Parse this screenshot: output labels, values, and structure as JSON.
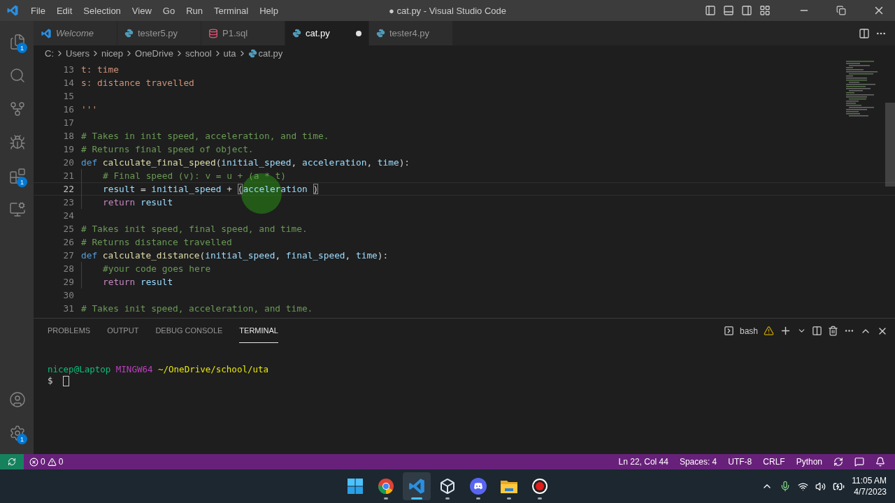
{
  "window": {
    "title": "● cat.py - Visual Studio Code"
  },
  "menu": [
    "File",
    "Edit",
    "Selection",
    "View",
    "Go",
    "Run",
    "Terminal",
    "Help"
  ],
  "activity_bar": {
    "top": [
      {
        "kind": "explorer",
        "badge": "1",
        "selected": false
      },
      {
        "kind": "search",
        "selected": false
      },
      {
        "kind": "source-control",
        "selected": false
      },
      {
        "kind": "debug",
        "selected": false
      },
      {
        "kind": "extensions",
        "badge": "1",
        "selected": false
      },
      {
        "kind": "remote",
        "selected": false
      }
    ],
    "bottom": [
      {
        "kind": "account",
        "selected": false
      },
      {
        "kind": "settings",
        "badge": "1",
        "selected": false
      }
    ]
  },
  "tabs": [
    {
      "label": "Welcome",
      "kind": "welcome",
      "preview": true,
      "selected": false,
      "modified": false
    },
    {
      "label": "tester5.py",
      "kind": "python",
      "preview": false,
      "selected": false,
      "modified": false
    },
    {
      "label": "P1.sql",
      "kind": "sql",
      "preview": false,
      "selected": false,
      "modified": false
    },
    {
      "label": "cat.py",
      "kind": "python",
      "preview": false,
      "selected": true,
      "modified": true
    },
    {
      "label": "tester4.py",
      "kind": "python",
      "preview": false,
      "selected": false,
      "modified": false
    }
  ],
  "breadcrumb": [
    {
      "label": "C:",
      "kind": "folder"
    },
    {
      "label": "Users",
      "kind": "folder"
    },
    {
      "label": "nicep",
      "kind": "folder"
    },
    {
      "label": "OneDrive",
      "kind": "folder"
    },
    {
      "label": "school",
      "kind": "folder"
    },
    {
      "label": "uta",
      "kind": "folder"
    },
    {
      "label": "cat.py",
      "kind": "python"
    }
  ],
  "editor": {
    "lines": [
      {
        "number": "13",
        "current": false,
        "indented": false,
        "tokens": [
          {
            "kind": "string",
            "text": "t: time"
          }
        ]
      },
      {
        "number": "14",
        "current": false,
        "indented": false,
        "tokens": [
          {
            "kind": "string",
            "text": "s: distance travelled"
          }
        ]
      },
      {
        "number": "15",
        "current": false
      },
      {
        "number": "16",
        "current": false,
        "indented": false,
        "tokens": [
          {
            "kind": "string",
            "text": "'''"
          }
        ]
      },
      {
        "number": "17",
        "current": false
      },
      {
        "number": "18",
        "current": false,
        "indented": false,
        "tokens": [
          {
            "kind": "comment",
            "text": "# Takes in init speed, acceleration, and time."
          }
        ]
      },
      {
        "number": "19",
        "current": false,
        "indented": false,
        "tokens": [
          {
            "kind": "comment",
            "text": "# Returns final speed of object."
          }
        ]
      },
      {
        "number": "20",
        "current": false,
        "indented": false,
        "tokens": [
          {
            "kind": "keyword",
            "text": "def "
          },
          {
            "kind": "function",
            "text": "calculate_final_speed"
          },
          {
            "kind": "plain",
            "text": "("
          },
          {
            "kind": "param",
            "text": "initial_speed"
          },
          {
            "kind": "plain",
            "text": ", "
          },
          {
            "kind": "param",
            "text": "acceleration"
          },
          {
            "kind": "plain",
            "text": ", "
          },
          {
            "kind": "param",
            "text": "time"
          },
          {
            "kind": "plain",
            "text": "):"
          }
        ]
      },
      {
        "number": "21",
        "current": false,
        "indented": true,
        "tokens": [
          {
            "kind": "comment",
            "text": "# Final speed (v): v = u + (a * t)"
          }
        ]
      },
      {
        "number": "22",
        "current": true,
        "indented": true,
        "tokens": [
          {
            "kind": "variable",
            "text": "result"
          },
          {
            "kind": "plain",
            "text": " = "
          },
          {
            "kind": "variable",
            "text": "initial_speed"
          },
          {
            "kind": "plain",
            "text": " + "
          },
          {
            "kind": "bracket",
            "text": "("
          },
          {
            "kind": "variable",
            "text": "acceleration "
          },
          {
            "kind": "bracket",
            "text": ")"
          }
        ]
      },
      {
        "number": "23",
        "current": false,
        "indented": true,
        "tokens": [
          {
            "kind": "control",
            "text": "return "
          },
          {
            "kind": "variable",
            "text": "result"
          }
        ]
      },
      {
        "number": "24",
        "current": false
      },
      {
        "number": "25",
        "current": false,
        "indented": false,
        "tokens": [
          {
            "kind": "comment",
            "text": "# Takes init speed, final speed, and time."
          }
        ]
      },
      {
        "number": "26",
        "current": false,
        "indented": false,
        "tokens": [
          {
            "kind": "comment",
            "text": "# Returns distance travelled"
          }
        ]
      },
      {
        "number": "27",
        "current": false,
        "indented": false,
        "tokens": [
          {
            "kind": "keyword",
            "text": "def "
          },
          {
            "kind": "function",
            "text": "calculate_distance"
          },
          {
            "kind": "plain",
            "text": "("
          },
          {
            "kind": "param",
            "text": "initial_speed"
          },
          {
            "kind": "plain",
            "text": ", "
          },
          {
            "kind": "param",
            "text": "final_speed"
          },
          {
            "kind": "plain",
            "text": ", "
          },
          {
            "kind": "param",
            "text": "time"
          },
          {
            "kind": "plain",
            "text": "):"
          }
        ]
      },
      {
        "number": "28",
        "current": false,
        "indented": true,
        "tokens": [
          {
            "kind": "comment",
            "text": "#your code goes here"
          }
        ]
      },
      {
        "number": "29",
        "current": false,
        "indented": true,
        "tokens": [
          {
            "kind": "control",
            "text": "return "
          },
          {
            "kind": "variable",
            "text": "result"
          }
        ]
      },
      {
        "number": "30",
        "current": false
      },
      {
        "number": "31",
        "current": false,
        "indented": false,
        "tokens": [
          {
            "kind": "comment",
            "text": "# Takes init speed, acceleration, and time."
          }
        ]
      }
    ]
  },
  "panel": {
    "tabs": [
      {
        "label": "PROBLEMS",
        "selected": false
      },
      {
        "label": "OUTPUT",
        "selected": false
      },
      {
        "label": "DEBUG CONSOLE",
        "selected": false
      },
      {
        "label": "TERMINAL",
        "selected": true
      }
    ],
    "terminal_name": "bash",
    "terminal": [
      {
        "tokens": [
          {
            "kind": "user",
            "text": "nicep@Laptop"
          },
          {
            "kind": "host",
            "text": "MINGW64"
          },
          {
            "kind": "path",
            "text": "~/OneDrive/school/uta"
          }
        ]
      },
      {
        "tokens": [
          {
            "kind": "plain",
            "text": "$"
          }
        ],
        "cursor": true
      }
    ]
  },
  "status_bar": {
    "errors": "0",
    "warnings": "0",
    "items": [
      "Ln 22, Col 44",
      "Spaces: 4",
      "UTF-8",
      "CRLF",
      "Python"
    ]
  },
  "taskbar": {
    "apps": [
      {
        "kind": "start",
        "running": false,
        "selected": false
      },
      {
        "kind": "chrome",
        "running": true,
        "selected": false
      },
      {
        "kind": "vscode",
        "running": true,
        "selected": true
      },
      {
        "kind": "cube",
        "running": true,
        "selected": false
      },
      {
        "kind": "discord",
        "running": true,
        "selected": false
      },
      {
        "kind": "folder",
        "running": true,
        "selected": false
      },
      {
        "kind": "recorder",
        "running": true,
        "selected": false
      }
    ],
    "time": "11:05 AM",
    "date": "4/7/2023"
  }
}
